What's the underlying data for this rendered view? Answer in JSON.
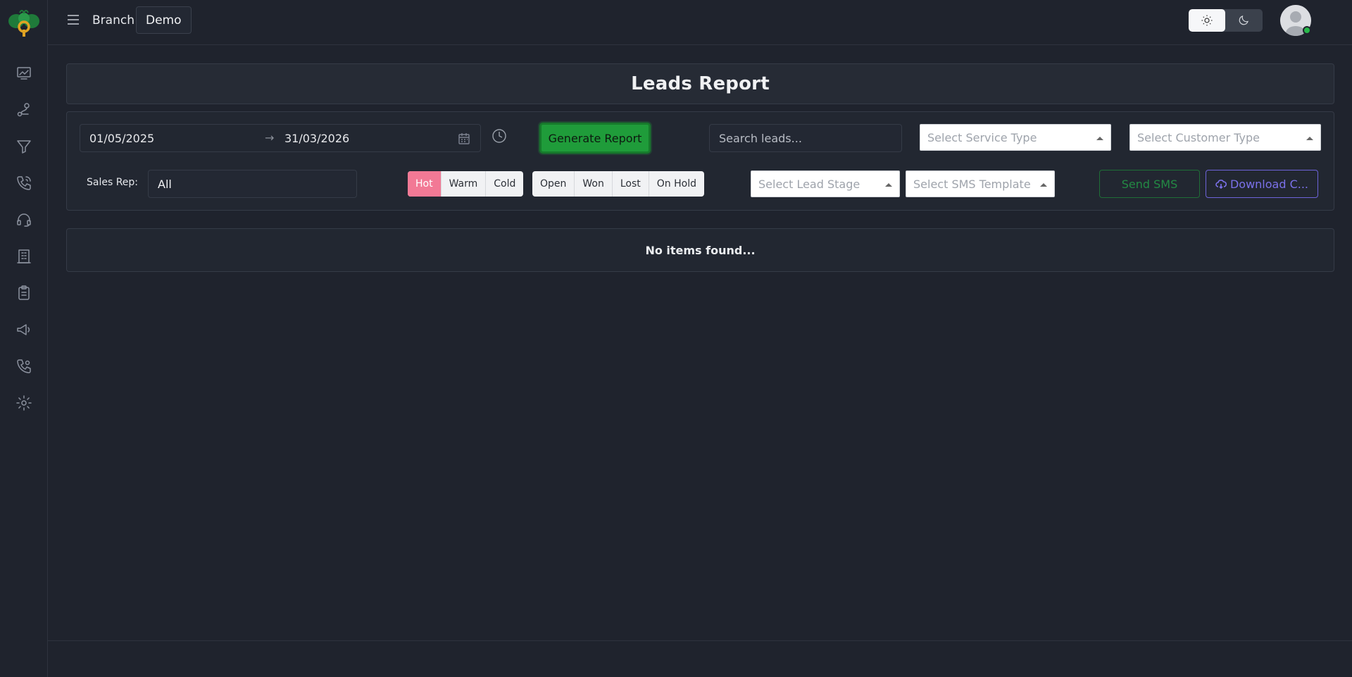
{
  "header": {
    "branch_label": "Branch",
    "branch_value": "Demo"
  },
  "sidebar": {
    "items": [
      {
        "icon": "dashboard-chart-icon"
      },
      {
        "icon": "route-icon"
      },
      {
        "icon": "filter-icon"
      },
      {
        "icon": "phone-call-icon"
      },
      {
        "icon": "headset-icon"
      },
      {
        "icon": "building-icon"
      },
      {
        "icon": "clipboard-list-icon"
      },
      {
        "icon": "megaphone-icon"
      },
      {
        "icon": "phone-settings-icon"
      },
      {
        "icon": "gear-icon"
      }
    ]
  },
  "page": {
    "title": "Leads Report",
    "empty_message": "No items found..."
  },
  "filters": {
    "date_start": "01/05/2025",
    "date_arrow": "→",
    "date_end": "31/03/2026",
    "generate_label": "Generate Report",
    "search_placeholder": "Search leads...",
    "service_type_placeholder": "Select Service Type",
    "customer_type_placeholder": "Select Customer Type",
    "sales_rep_label": "Sales Rep:",
    "sales_rep_value": "All",
    "temperature": [
      "Hot",
      "Warm",
      "Cold"
    ],
    "temperature_active": "Hot",
    "status": [
      "Open",
      "Won",
      "Lost",
      "On Hold"
    ],
    "lead_stage_placeholder": "Select Lead Stage",
    "sms_template_placeholder": "Select SMS Template",
    "send_sms_label": "Send SMS",
    "download_label": "Download C..."
  },
  "colors": {
    "background": "#1f232d",
    "accent_green": "#1f9c3a",
    "hot_pink": "#f27995",
    "download_purple": "#7b71ea"
  }
}
